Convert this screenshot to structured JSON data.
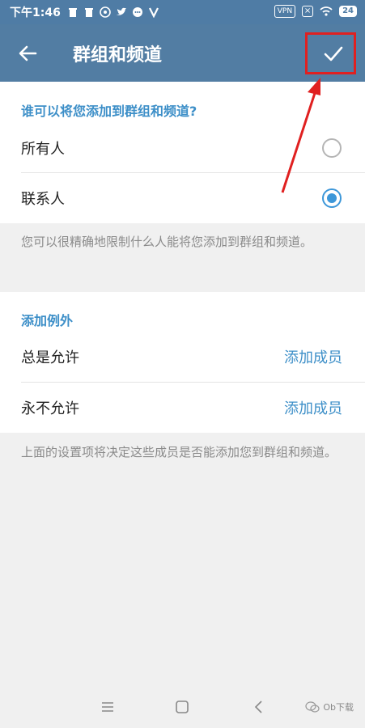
{
  "status_bar": {
    "time": "下午1:46",
    "vpn": "VPN",
    "battery": "24"
  },
  "app_bar": {
    "title": "群组和频道"
  },
  "who_can_add": {
    "header": "谁可以将您添加到群组和频道?",
    "options": [
      {
        "label": "所有人",
        "selected": false
      },
      {
        "label": "联系人",
        "selected": true
      }
    ],
    "note": "您可以很精确地限制什么人能将您添加到群组和频道。"
  },
  "exceptions": {
    "header": "添加例外",
    "rows": [
      {
        "label": "总是允许",
        "action": "添加成员"
      },
      {
        "label": "永不允许",
        "action": "添加成员"
      }
    ],
    "note": "上面的设置项将决定这些成员是否能添加您到群组和频道。"
  },
  "watermark": "Ob下载",
  "colors": {
    "app_bar": "#527da3",
    "accent": "#3d8fc8",
    "radio_on": "#3d97d9",
    "annotation": "#e02020"
  }
}
